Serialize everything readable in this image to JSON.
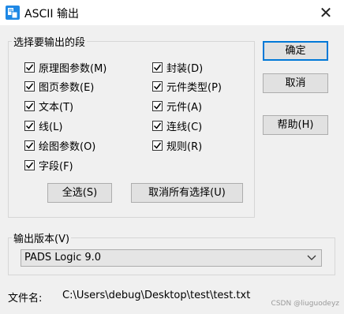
{
  "window": {
    "title": "ASCII 输出",
    "close_glyph": "✕",
    "icon": "app-document-icon"
  },
  "section": {
    "label": "选择要输出的段",
    "checkboxes": [
      {
        "label": "原理图参数(M)",
        "checked": true
      },
      {
        "label": "图页参数(E)",
        "checked": true
      },
      {
        "label": "文本(T)",
        "checked": true
      },
      {
        "label": "线(L)",
        "checked": true
      },
      {
        "label": "绘图参数(O)",
        "checked": true
      },
      {
        "label": "字段(F)",
        "checked": true
      },
      {
        "label": "封装(D)",
        "checked": true
      },
      {
        "label": "元件类型(P)",
        "checked": true
      },
      {
        "label": "元件(A)",
        "checked": true
      },
      {
        "label": "连线(C)",
        "checked": true
      },
      {
        "label": "规则(R)",
        "checked": true
      }
    ],
    "select_all": "全选(S)",
    "deselect_all": "取消所有选择(U)"
  },
  "buttons": {
    "ok": "确定",
    "cancel": "取消",
    "help": "帮助(H)"
  },
  "version": {
    "label": "输出版本(V)",
    "value": "PADS Logic 9.0"
  },
  "file": {
    "label": "文件名:",
    "path": "C:\\Users\\debug\\Desktop\\test\\test.txt"
  },
  "watermark": "CSDN @liuguodeyz",
  "colors": {
    "accent": "#0078d7",
    "icon_blue": "#1e88e5"
  }
}
